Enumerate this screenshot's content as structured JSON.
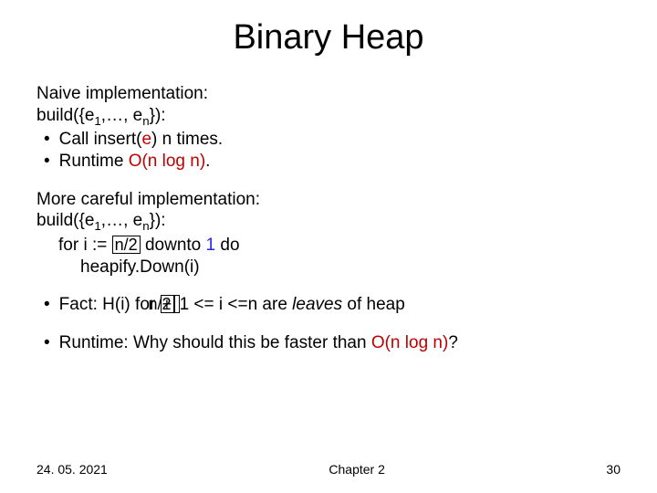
{
  "title": "Binary Heap",
  "naive": {
    "heading": "Naive implementation:",
    "build_pre": "build({e",
    "sub1": "1",
    "build_mid": ",…, e",
    "subn": "n",
    "build_post": "}):",
    "line1_pre": "Call insert(",
    "line1_arg": "e",
    "line1_post": ") n times.",
    "line2_pre": "Runtime ",
    "line2_o": "O(n log n)",
    "line2_post": "."
  },
  "careful": {
    "heading": "More careful implementation:",
    "build_pre": "build({e",
    "sub1": "1",
    "build_mid": ",…, e",
    "subn": "n",
    "build_post": "}):",
    "for_pre": "for i :=",
    "floor1": "n/2",
    "for_mid": "downto ",
    "for_one": "1",
    "for_post": " do",
    "heapify": "heapify.Down(i)"
  },
  "fact": {
    "pre": "Fact: H(i) for ",
    "floor2": "n/2",
    "plus": "+",
    "mid": "1 <= i <=n are ",
    "leaves": "leaves",
    "post": " of heap"
  },
  "runtime_q_pre": "Runtime: Why should this be faster than ",
  "runtime_q_o": "O(n log n)",
  "runtime_q_post": "?",
  "footer": {
    "date": "24. 05. 2021",
    "chapter": "Chapter 2",
    "page": "30"
  }
}
